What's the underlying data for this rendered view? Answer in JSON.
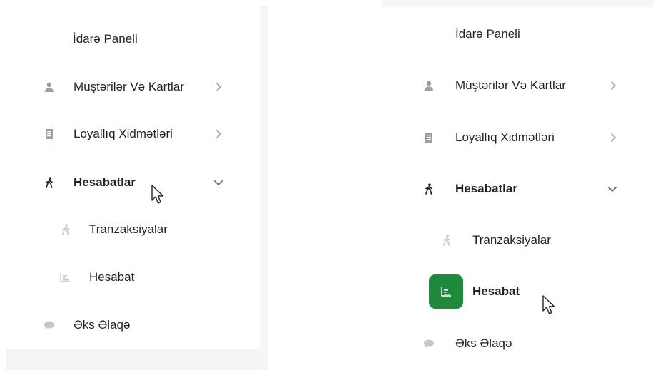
{
  "menu": {
    "dashboard": "İdarə Paneli",
    "customers": "Müştərilər Və Kartlar",
    "loyalty": "Loyallıq Xidmətləri",
    "reports": "Hesabatlar",
    "transactions": "Tranzaksiyalar",
    "report": "Hesabat",
    "feedback": "Əks Əlaqə"
  },
  "colors": {
    "icon_gray": "#9aa0a6",
    "icon_light": "#c4c8cc",
    "active_green": "#1f8a3c",
    "text": "#1f2329"
  }
}
